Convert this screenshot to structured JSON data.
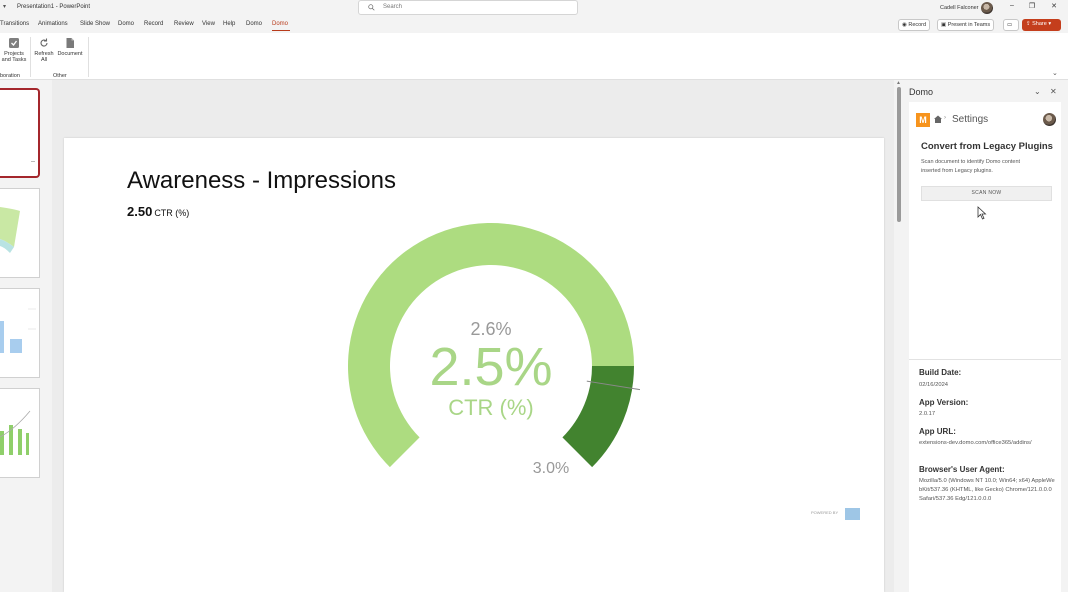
{
  "window": {
    "title": "Presentation1 - PowerPoint",
    "search_placeholder": "Search",
    "user_name": "Cadell Falconer"
  },
  "menu": {
    "items": [
      "Transitions",
      "Animations",
      "Slide Show",
      "Domo",
      "Record",
      "Review",
      "View",
      "Help",
      "Domo",
      "Domo"
    ],
    "active_index": 9,
    "record_button": "Record",
    "present_button": "Present in Teams",
    "share_button": "Share"
  },
  "ribbon": {
    "projects_label": "Projects and Tasks",
    "collab_group_label": "boration",
    "refresh_label": "Refresh All",
    "document_label": "Document",
    "other_group_label": "Other"
  },
  "slide": {
    "title": "Awareness - Impressions",
    "ctr_value": "2.50",
    "ctr_label": "CTR (%)",
    "powered_by": "POWERED BY"
  },
  "gauge": {
    "value_text": "2.5%",
    "label_text": "CTR (%)",
    "marker_label": "2.6%",
    "max_label": "3.0%",
    "value": 2.5,
    "marker": 2.6,
    "min": 0,
    "max": 3.0,
    "colors": {
      "light": "#addc80",
      "dark": "#42832f",
      "text": "#a9d687",
      "label": "#999999"
    }
  },
  "pane": {
    "title": "Domo",
    "breadcrumb": "Settings",
    "heading": "Convert from Legacy Plugins",
    "description": "Scan document to identify Domo content inserted from Legacy plugins.",
    "scan_button": "SCAN NOW",
    "build_date_label": "Build Date:",
    "build_date": "02/16/2024",
    "app_version_label": "App Version:",
    "app_version": "2.0.17",
    "app_url_label": "App URL:",
    "app_url": "extensions-dev.domo.com/office365/addins/",
    "user_agent_label": "Browser's User Agent:",
    "user_agent": "Mozilla/5.0 (Windows NT 10.0; Win64; x64) AppleWebKit/537.36 (KHTML, like Gecko) Chrome/121.0.0.0 Safari/537.36 Edg/121.0.0.0"
  }
}
